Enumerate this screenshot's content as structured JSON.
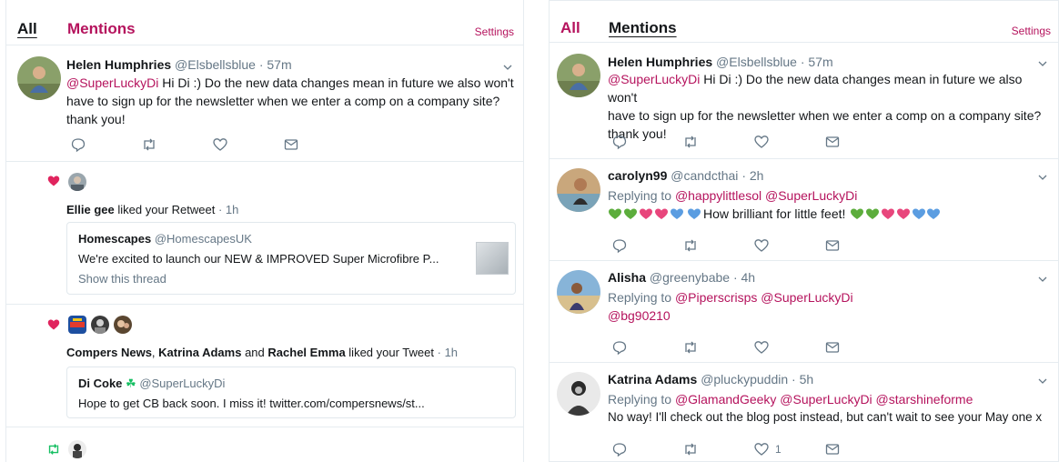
{
  "colors": {
    "accent": "#b5135d",
    "muted": "#657786",
    "text": "#14171a",
    "heart": "#e0245e",
    "retweet": "#17bf63"
  },
  "left": {
    "tabs": {
      "all": "All",
      "mentions": "Mentions",
      "settings": "Settings"
    },
    "tweet": {
      "name": "Helen Humphries",
      "handle": "@Elsbellsblue",
      "time": "· 57m",
      "mention": "@SuperLuckyDi",
      "text_line1": "Hi Di :)  Do the new data changes mean in future we also won't",
      "text_line2": "have to sign up for the newsletter when we enter a comp on a company site?",
      "text_line3": "thank you!"
    },
    "notif1": {
      "user": "Ellie gee",
      "action": "liked your Retweet",
      "time": "· 1h",
      "quote_name": "Homescapes",
      "quote_handle": "@HomescapesUK",
      "quote_text": "We're excited to launch our NEW & IMPROVED Super Microfibre P...",
      "quote_link": "Show this thread"
    },
    "notif2": {
      "user1": "Compers News",
      "sep1": ",",
      "user2": "Katrina Adams",
      "and": "and",
      "user3": "Rachel Emma",
      "action": "liked your Tweet",
      "time": "· 1h",
      "quote_name": "Di Coke",
      "quote_clover": "☘",
      "quote_handle": "@SuperLuckyDi",
      "quote_text": "Hope to get CB back soon. I miss it! twitter.com/compersnews/st..."
    },
    "notif3": {
      "icon": "retweet-icon"
    }
  },
  "right": {
    "tabs": {
      "all": "All",
      "mentions": "Mentions",
      "settings": "Settings"
    },
    "tweets": [
      {
        "name": "Helen Humphries",
        "handle": "@Elsbellsblue",
        "time": "· 57m",
        "mention": "@SuperLuckyDi",
        "text_line1": "Hi Di :)  Do the new data changes mean in future we also won't",
        "text_line2": "have to sign up for the newsletter when we enter a comp on a company site?",
        "text_line3": "thank you!"
      },
      {
        "name": "carolyn99",
        "handle": "@candcthai",
        "time": "· 2h",
        "replying": "Replying to",
        "reply_mentions": "@happylittlesol @SuperLuckyDi",
        "text": "How brilliant for little feet!"
      },
      {
        "name": "Alisha",
        "handle": "@greenybabe",
        "time": "· 4h",
        "replying": "Replying to",
        "reply_mentions": "@Piperscrisps @SuperLuckyDi",
        "text": "@bg90210"
      },
      {
        "name": "Katrina Adams",
        "handle": "@pluckypuddin",
        "time": "· 5h",
        "replying": "Replying to",
        "reply_mentions": "@GlamandGeeky @SuperLuckyDi @starshineforme",
        "text": "No way! I'll check out the blog post instead, but can't wait to see your May one x",
        "like_count": "1"
      }
    ]
  }
}
